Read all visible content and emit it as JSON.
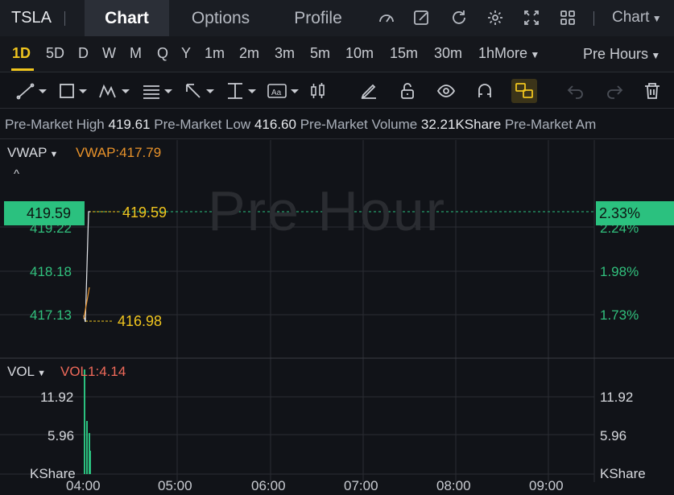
{
  "header": {
    "ticker": "TSLA",
    "tabs": [
      "Chart",
      "Options",
      "Profile"
    ],
    "active_tab": "Chart",
    "chart_menu": "Chart"
  },
  "periods": {
    "items": [
      "1D",
      "5D",
      "D",
      "W",
      "M",
      "Q",
      "Y",
      "1m",
      "2m",
      "3m",
      "5m",
      "10m",
      "15m",
      "30m",
      "1h"
    ],
    "more": "More",
    "active": "1D",
    "session": "Pre Hours"
  },
  "info": {
    "high_label": "Pre-Market High",
    "high_value": "419.61",
    "low_label": "Pre-Market Low",
    "low_value": "416.60",
    "volume_label": "Pre-Market Volume",
    "volume_value": "32.21KShare",
    "amount_label": "Pre-Market Am"
  },
  "main_panel": {
    "indicator": "VWAP",
    "indicator_value": "VWAP:417.79",
    "watermark": "Pre Hour",
    "current_price": "419.59",
    "current_pct": "2.33%",
    "price_ticks": [
      "419.22",
      "418.18",
      "417.13"
    ],
    "pct_ticks": [
      "2.24%",
      "1.98%",
      "1.73%"
    ],
    "high_marker": "419.59",
    "low_marker": "416.98"
  },
  "volume_panel": {
    "indicator": "VOL",
    "indicator_value": "VOL1:4.14",
    "ticks": [
      "11.92",
      "5.96",
      "KShare"
    ],
    "right_ticks": [
      "11.92",
      "5.96",
      "KShare"
    ]
  },
  "x_axis": [
    "04:00",
    "05:00",
    "06:00",
    "07:00",
    "08:00",
    "09:00"
  ],
  "colors": {
    "accent": "#f0c51e",
    "up": "#2bc17f",
    "vwap": "#e8922a",
    "vol": "#f06a5a"
  }
}
